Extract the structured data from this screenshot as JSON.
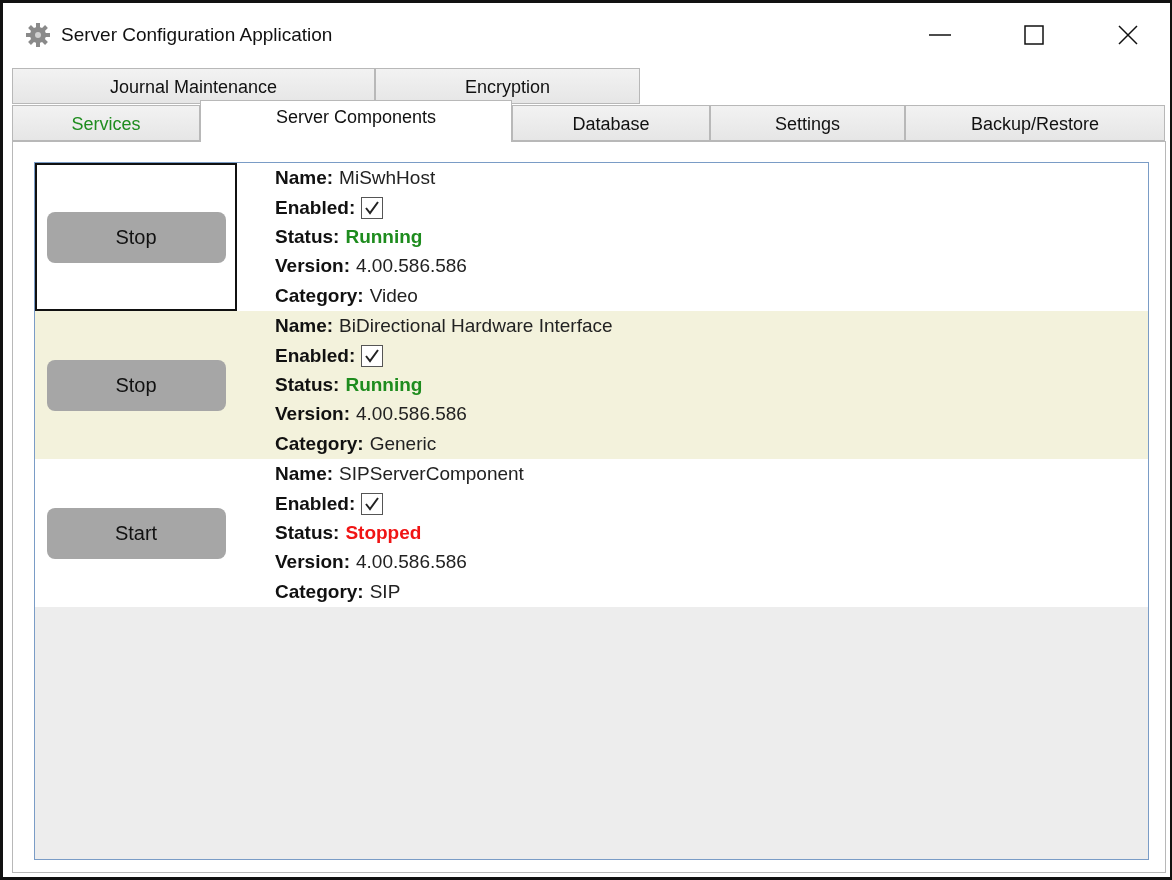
{
  "window": {
    "title": "Server Configuration Application"
  },
  "tab_rows": [
    [
      {
        "label": "Journal Maintenance",
        "selected": false
      },
      {
        "label": "Encryption",
        "selected": false
      }
    ],
    [
      {
        "label": "Services",
        "selected": false,
        "color": "#1e8c1e"
      },
      {
        "label": "Server Components",
        "selected": true
      },
      {
        "label": "Database",
        "selected": false
      },
      {
        "label": "Settings",
        "selected": false
      },
      {
        "label": "Backup/Restore",
        "selected": false
      }
    ]
  ],
  "components": [
    {
      "button": "Stop",
      "focused": true,
      "selected": false,
      "fields": [
        {
          "label": "Name:",
          "value": "MiSwhHost"
        },
        {
          "label": "Enabled:",
          "kind": "checkbox",
          "checked": true
        },
        {
          "label": "Status:",
          "value": "Running",
          "color": "#1e8c1e"
        },
        {
          "label": "Version:",
          "value": "4.00.586.586"
        },
        {
          "label": "Category:",
          "value": "Video"
        }
      ]
    },
    {
      "button": "Stop",
      "focused": false,
      "selected": true,
      "fields": [
        {
          "label": "Name:",
          "value": "BiDirectional Hardware Interface"
        },
        {
          "label": "Enabled:",
          "kind": "checkbox",
          "checked": true
        },
        {
          "label": "Status:",
          "value": "Running",
          "color": "#1e8c1e"
        },
        {
          "label": "Version:",
          "value": "4.00.586.586"
        },
        {
          "label": "Category:",
          "value": "Generic"
        }
      ]
    },
    {
      "button": "Start",
      "focused": false,
      "selected": false,
      "fields": [
        {
          "label": "Name:",
          "value": "SIPServerComponent"
        },
        {
          "label": "Enabled:",
          "kind": "checkbox",
          "checked": true
        },
        {
          "label": "Status:",
          "value": "Stopped",
          "color": "#f01414"
        },
        {
          "label": "Version:",
          "value": "4.00.586.586"
        },
        {
          "label": "Category:",
          "value": "SIP"
        }
      ]
    }
  ]
}
